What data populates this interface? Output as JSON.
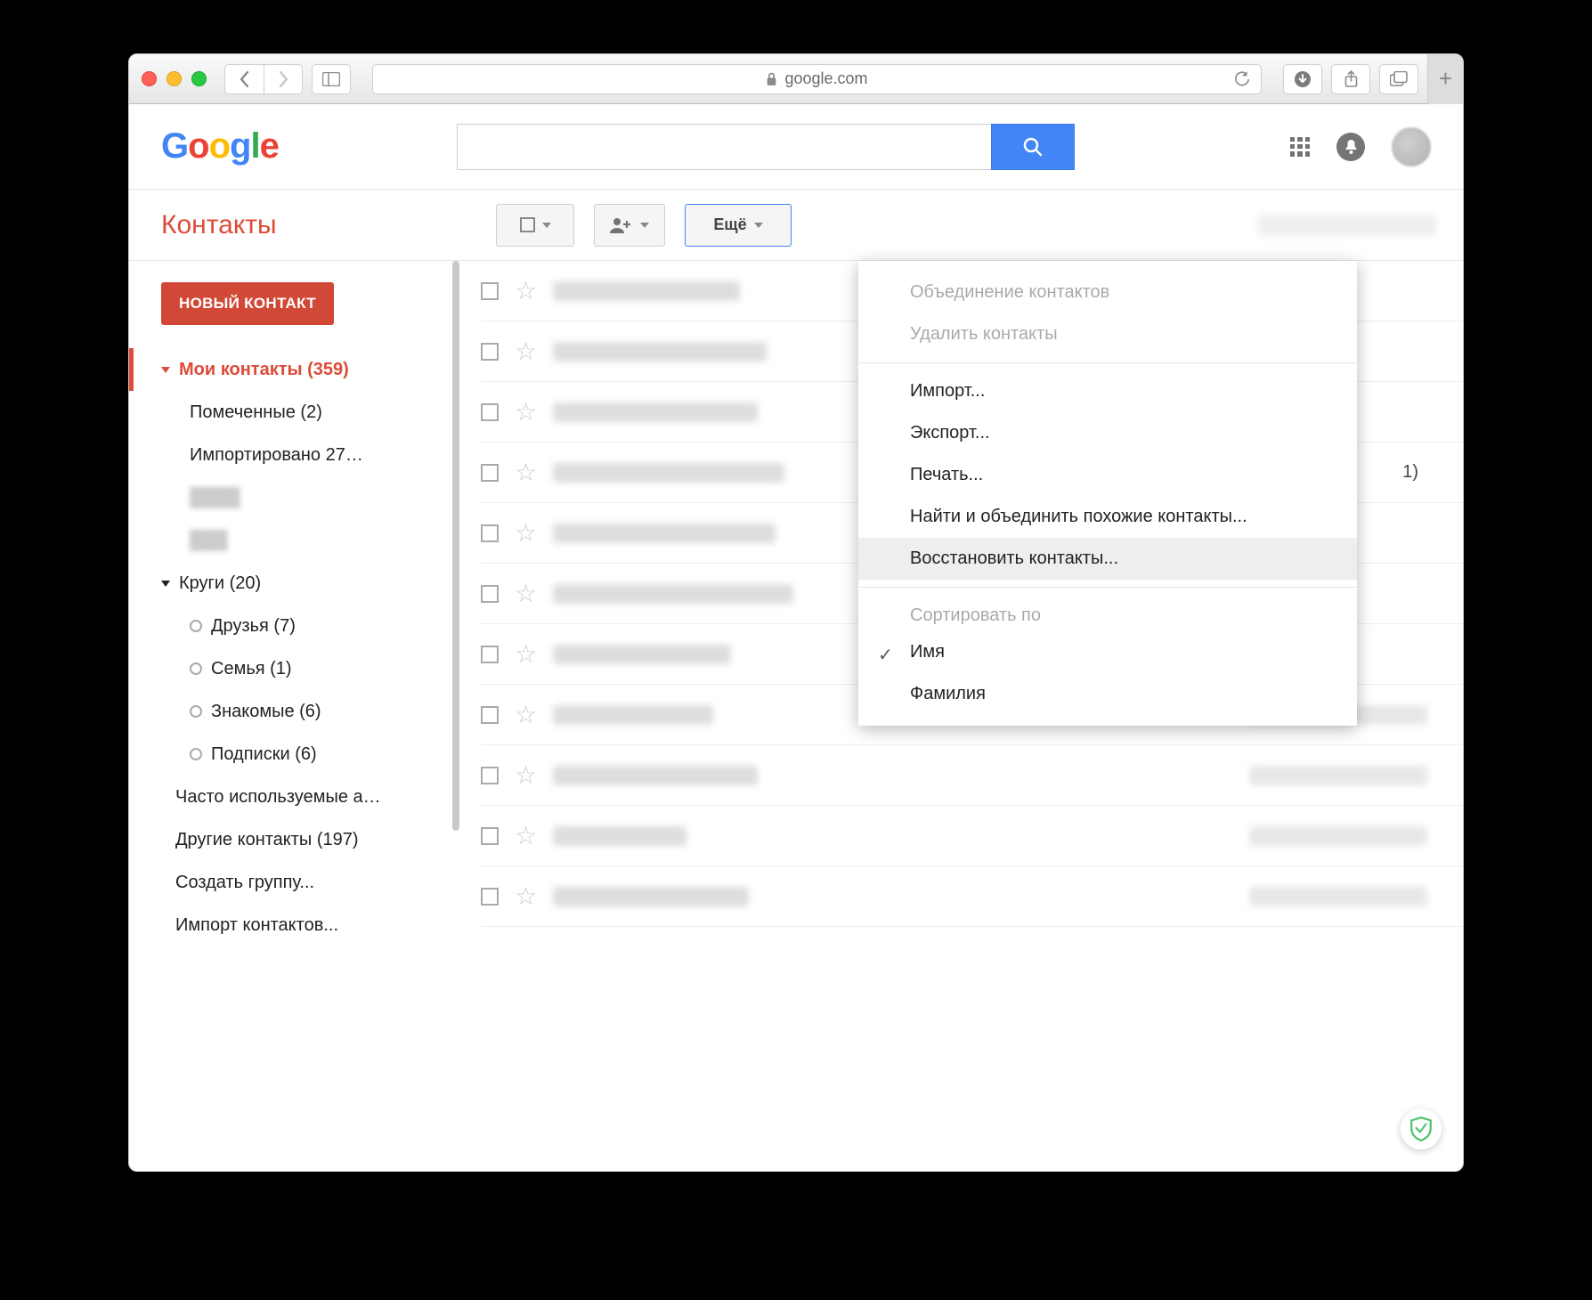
{
  "browser": {
    "url_host": "google.com"
  },
  "header": {
    "logo_text": "Google",
    "search_value": ""
  },
  "toolbar": {
    "page_title": "Контакты",
    "more_label": "Ещё"
  },
  "sidebar": {
    "new_contact": "НОВЫЙ КОНТАКТ",
    "my_contacts": {
      "label": "Мои контакты",
      "count": 359
    },
    "starred": {
      "label": "Помеченные",
      "count": 2
    },
    "imported": "Импортировано 27…",
    "circles": {
      "label": "Круги",
      "count": 20
    },
    "circles_items": [
      {
        "label": "Друзья",
        "count": 7
      },
      {
        "label": "Семья",
        "count": 1
      },
      {
        "label": "Знакомые",
        "count": 6
      },
      {
        "label": "Подписки",
        "count": 6
      }
    ],
    "frequent": "Часто используемые а…",
    "other": {
      "label": "Другие контакты",
      "count": 197
    },
    "create_group": "Создать группу...",
    "import": "Импорт контактов..."
  },
  "dropdown": {
    "merge": "Объединение контактов",
    "delete": "Удалить контакты",
    "import": "Импорт...",
    "export": "Экспорт...",
    "print": "Печать...",
    "find_merge": "Найти и объединить похожие контакты...",
    "restore": "Восстановить контакты...",
    "sort_label": "Сортировать по",
    "sort_name": "Имя",
    "sort_lastname": "Фамилия"
  },
  "contacts": {
    "rows": [
      {
        "name_w": 210,
        "phone": false,
        "trail": ""
      },
      {
        "name_w": 240,
        "phone": false,
        "trail": ""
      },
      {
        "name_w": 230,
        "phone": false,
        "trail": ""
      },
      {
        "name_w": 260,
        "phone": false,
        "trail": "1)"
      },
      {
        "name_w": 250,
        "phone": false,
        "trail": ""
      },
      {
        "name_w": 270,
        "phone": false,
        "trail": ""
      },
      {
        "name_w": 200,
        "phone": false,
        "trail": ""
      },
      {
        "name_w": 180,
        "phone": true,
        "trail": ""
      },
      {
        "name_w": 230,
        "phone": true,
        "trail": ""
      },
      {
        "name_w": 150,
        "phone": true,
        "trail": ""
      },
      {
        "name_w": 220,
        "phone": true,
        "trail": ""
      }
    ]
  }
}
